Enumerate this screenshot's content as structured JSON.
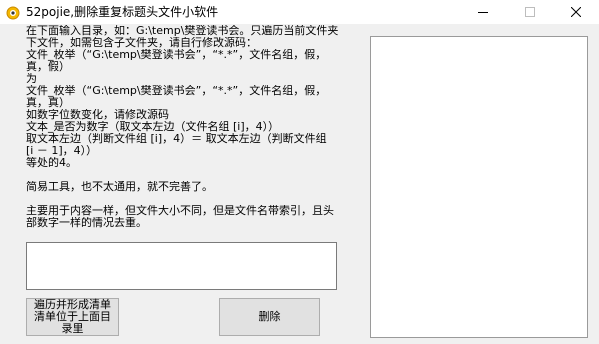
{
  "window": {
    "title": "52pojie,删除重复标题头文件小软件",
    "controls": {
      "minimize_icon": "minimize-icon",
      "maximize_icon": "maximize-icon",
      "close_icon": "close-icon"
    }
  },
  "instructions": {
    "lines": [
      "在下面输入目录，如：G:\\temp\\樊登读书会。只遍历当前文件夹",
      "下文件，如需包含子文件夹，请自行修改源码：",
      "文件_枚举（“G:\\temp\\樊登读书会”，“*.*”，文件名组，假，",
      "真，假）",
      "为",
      "文件_枚举（“G:\\temp\\樊登读书会”，“*.*”，文件名组，假，",
      "真，真）",
      "如数字位数变化，请修改源码",
      "文本_是否为数字（取文本左边（文件名组 [i]，4））",
      "取文本左边（判断文件组 [i]，4）＝ 取文本左边（判断文件组",
      "[i － 1]，4））",
      "等处的4。",
      "",
      "简易工具，也不太通用，就不完善了。",
      "",
      "主要用于内容一样，但文件大小不同，但是文件名带索引，且头",
      "部数字一样的情况去重。"
    ]
  },
  "input": {
    "value": "",
    "placeholder": ""
  },
  "buttons": {
    "enumerate_label": "遍历并形成清单清单位于上面目录里",
    "delete_label": "删除"
  },
  "colors": {
    "window_bg": "#f0f0f0",
    "titlebar_bg": "#ffffff",
    "button_bg": "#e1e1e1"
  }
}
